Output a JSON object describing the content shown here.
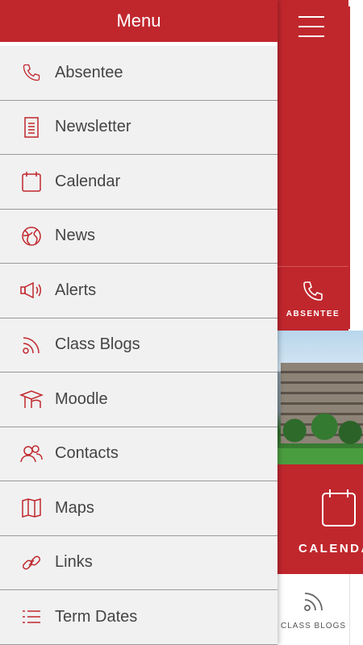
{
  "drawer": {
    "title": "Menu",
    "items": [
      {
        "label": "Absentee",
        "icon": "phone-icon"
      },
      {
        "label": "Newsletter",
        "icon": "document-icon"
      },
      {
        "label": "Calendar",
        "icon": "calendar-icon"
      },
      {
        "label": "News",
        "icon": "globe-icon"
      },
      {
        "label": "Alerts",
        "icon": "megaphone-icon"
      },
      {
        "label": "Class Blogs",
        "icon": "rss-icon"
      },
      {
        "label": "Moodle",
        "icon": "graduation-cap-icon"
      },
      {
        "label": "Contacts",
        "icon": "people-icon"
      },
      {
        "label": "Maps",
        "icon": "map-icon"
      },
      {
        "label": "Links",
        "icon": "link-icon"
      },
      {
        "label": "Term Dates",
        "icon": "list-icon"
      }
    ]
  },
  "background": {
    "absentee_label": "ABSENTEE",
    "calendar_label": "CALENDA",
    "class_blogs_label": "CLASS BLOGS"
  },
  "colors": {
    "accent": "#c0272d",
    "drawer_bg": "#f1f1f1",
    "text": "#444444"
  }
}
